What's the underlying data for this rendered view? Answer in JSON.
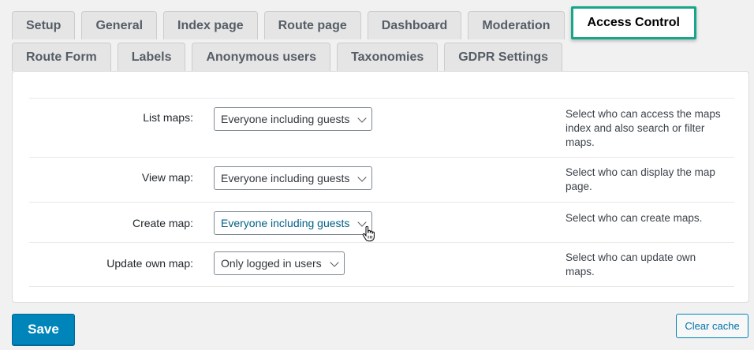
{
  "tabs_row1": [
    {
      "label": "Setup",
      "active": false
    },
    {
      "label": "General",
      "active": false
    },
    {
      "label": "Index page",
      "active": false
    },
    {
      "label": "Route page",
      "active": false
    },
    {
      "label": "Dashboard",
      "active": false
    },
    {
      "label": "Moderation",
      "active": false
    },
    {
      "label": "Access Control",
      "active": true
    }
  ],
  "tabs_row2": [
    {
      "label": "Route Form"
    },
    {
      "label": "Labels"
    },
    {
      "label": "Anonymous users"
    },
    {
      "label": "Taxonomies"
    },
    {
      "label": "GDPR Settings"
    }
  ],
  "settings": [
    {
      "label": "List maps:",
      "value": "Everyone including guests",
      "description": "Select who can access the maps index and also search or filter maps."
    },
    {
      "label": "View map:",
      "value": "Everyone including guests",
      "description": "Select who can display the map page."
    },
    {
      "label": "Create map:",
      "value": "Everyone including guests",
      "description": "Select who can create maps."
    },
    {
      "label": "Update own map:",
      "value": "Only logged in users",
      "description": "Select who can update own maps."
    }
  ],
  "buttons": {
    "save": "Save",
    "clear_cache": "Clear cache"
  },
  "colors": {
    "active_tab_border": "#17a68a",
    "primary": "#0085ba",
    "link": "#0073aa"
  }
}
